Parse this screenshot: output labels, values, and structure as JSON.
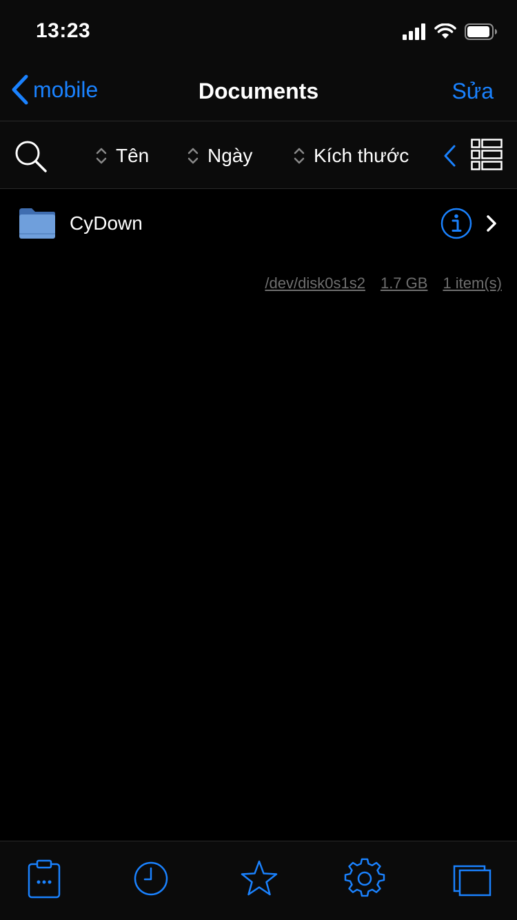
{
  "status_bar": {
    "time": "13:23"
  },
  "nav": {
    "back_label": "mobile",
    "title": "Documents",
    "edit_label": "Sửa"
  },
  "toolbar": {
    "sort_name": "Tên",
    "sort_date": "Ngày",
    "sort_size": "Kích thước"
  },
  "files": [
    {
      "name": "CyDown",
      "type": "folder"
    }
  ],
  "footer": {
    "device": "/dev/disk0s1s2",
    "size": "1.7 GB",
    "count": "1 item(s)"
  },
  "colors": {
    "accent": "#1a82ff",
    "background": "#000000",
    "bar_background": "#0b0b0b",
    "muted_text": "#6f6f6f",
    "folder": "#6f9fdc"
  },
  "icons": {
    "status": [
      "cellular-signal-icon",
      "wifi-icon",
      "battery-icon"
    ],
    "tabs": [
      "clipboard-icon",
      "clock-icon",
      "star-icon",
      "gear-icon",
      "windows-icon"
    ]
  }
}
